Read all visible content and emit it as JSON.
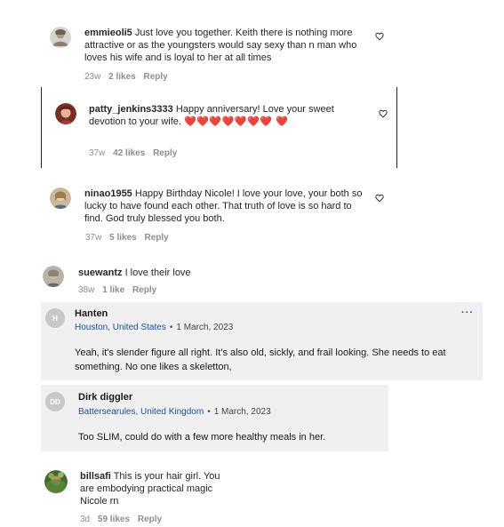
{
  "instagram_comments": [
    {
      "username": "emmieoli5",
      "text": " Just love you together. Keith there is nothing more attractive or as the youngsters would say sexy than n man who loves his wife and is loyal to her at all times",
      "age": "23w",
      "likes": "2 likes",
      "reply": "Reply"
    },
    {
      "username": "patty_jenkins3333",
      "text": " Happy anniversary! Love your sweet devotion to your wife.",
      "hearts": "❤️❤️❤️❤️❤️❤️❤️ ❤️",
      "age": "37w",
      "likes": "42 likes",
      "reply": "Reply"
    },
    {
      "username": "ninao1955",
      "text": " Happy Birthday Nicole! I love your love, your both so lucky to have found each other. That truth of love is so hard to find. God truly blessed you both.",
      "age": "37w",
      "likes": "5 likes",
      "reply": "Reply"
    },
    {
      "username": "suewantz",
      "text": " I love their love",
      "age": "38w",
      "likes": "1 like",
      "reply": "Reply"
    }
  ],
  "news_comments": [
    {
      "initials": "H",
      "name": "Hanten",
      "location": "Houston, United States",
      "separator": "•",
      "date": "1 March, 2023",
      "text": "Yeah, it's slender figure all right. It's also old, sickly, and frail looking. She needs to eat something. No one likes a skeletton,",
      "more": "···"
    },
    {
      "initials": "DD",
      "name": "Dirk diggler",
      "location": "Battersearules, United Kingdom",
      "separator": "•",
      "date": "1 March, 2023",
      "text": "Too SLIM, could do with a few more healthy meals in her."
    }
  ],
  "final_comment": {
    "username": "billsafi",
    "text": " This is your hair girl. You are embodying practical magic Nicole rn",
    "age": "3d",
    "likes": "59 likes",
    "reply": "Reply"
  },
  "icons": {
    "like": "heart-outline-icon",
    "more": "more-dots-icon"
  },
  "colors": {
    "link": "#1a4fa0",
    "heart": "#e0245e",
    "news_bg": "#f0f0f0",
    "meta": "#8e8e8e"
  }
}
